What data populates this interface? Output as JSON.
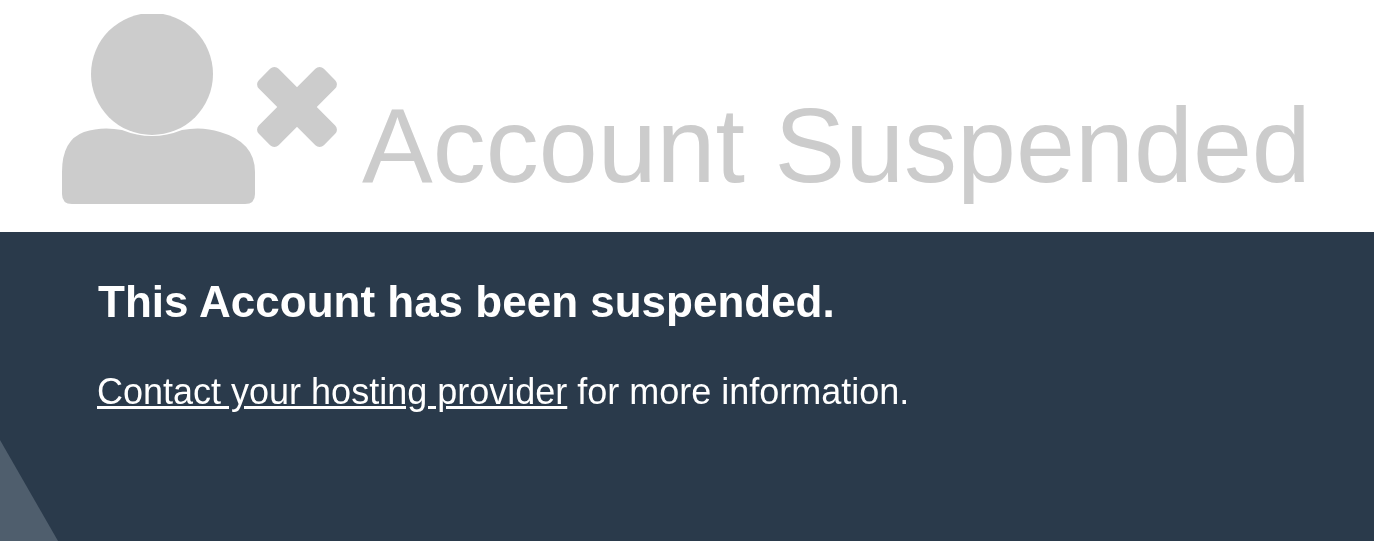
{
  "header": {
    "title": "Account Suspended"
  },
  "message": {
    "heading": "This Account has been suspended.",
    "link": "Contact your hosting provider",
    "text": " for more information."
  }
}
